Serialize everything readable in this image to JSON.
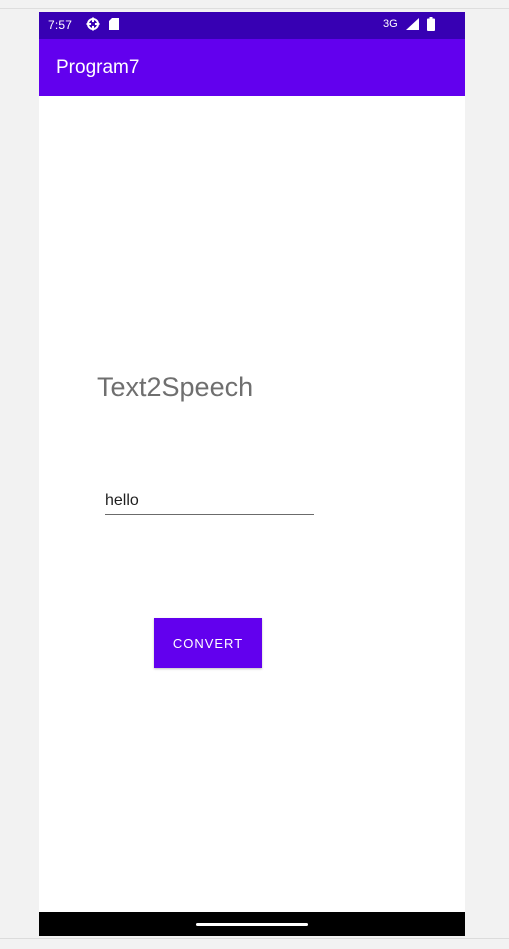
{
  "status_bar": {
    "time": "7:57",
    "network": "3G",
    "icons": [
      "settings-gear-icon",
      "sd-card-icon",
      "signal-icon",
      "battery-icon"
    ],
    "background": "#3700b3"
  },
  "app_bar": {
    "title": "Program7",
    "background": "#6200ee"
  },
  "main": {
    "heading": "Text2Speech",
    "input_value": "hello",
    "convert_button_label": "CONVERT",
    "accent": "#6200ee"
  },
  "nav_bar": {
    "icons": [
      "home-handle-icon"
    ],
    "background": "#000000"
  }
}
